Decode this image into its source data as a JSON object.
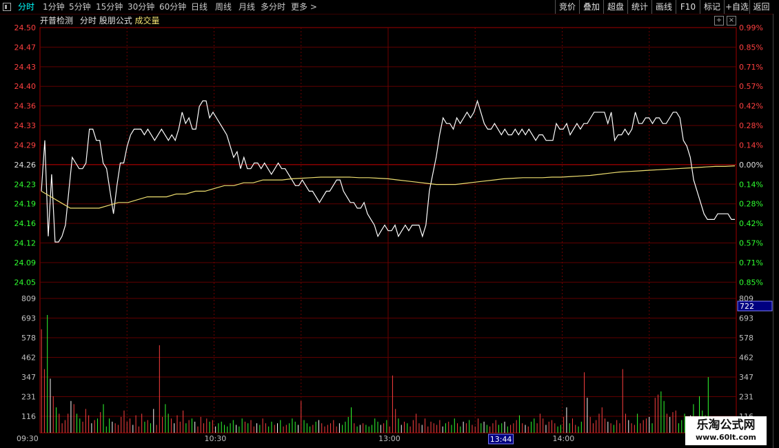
{
  "toolbar": {
    "left_tabs": [
      "分时",
      "1分钟",
      "5分钟",
      "15分钟",
      "30分钟",
      "60分钟",
      "日线",
      "周线",
      "月线",
      "多分时",
      "更多"
    ],
    "right_buttons": [
      "竞价",
      "叠加",
      "超盘",
      "统计",
      "画线",
      "F10",
      "标记",
      "+自选",
      "返回"
    ]
  },
  "subtitle": {
    "items": [
      "开普检测",
      "分时",
      "股朋公式",
      "成交量"
    ],
    "colors": [
      "#e0e0e0",
      "#e0e0e0",
      "#e0e0e0",
      "#f0e070"
    ]
  },
  "price_axis": {
    "left_labels": [
      "24.50",
      "24.47",
      "24.43",
      "24.40",
      "24.36",
      "24.33",
      "24.29",
      "24.26",
      "24.23",
      "24.19",
      "24.16",
      "24.12",
      "24.09",
      "24.05"
    ],
    "right_labels": [
      "0.99%",
      "0.85%",
      "0.71%",
      "0.57%",
      "0.42%",
      "0.28%",
      "0.14%",
      "0.00%",
      "0.14%",
      "0.28%",
      "0.42%",
      "0.57%",
      "0.71%",
      "0.85%"
    ],
    "prev_close": 24.26,
    "colors": {
      "up": "#ff4040",
      "flat": "#e0e0e0",
      "down": "#30ff30"
    }
  },
  "volume_axis": {
    "labels": [
      "809",
      "693",
      "578",
      "462",
      "347",
      "231",
      "116"
    ],
    "cursor_value": "722"
  },
  "time_axis": {
    "labels": [
      "09:30",
      "10:30",
      "13:00",
      "14:00"
    ],
    "cursor_time": "13:44"
  },
  "watermark": {
    "line1": "乐淘公式网",
    "line2": "www.60lt.com"
  },
  "chart_data": {
    "type": "line",
    "title": "",
    "xlabel": "",
    "ylabel": "",
    "x_range_minutes": [
      0,
      240
    ],
    "ylim": [
      24.02,
      24.5
    ],
    "series": [
      {
        "color": "#ffffff",
        "values": [
          24.21,
          24.3,
          24.13,
          24.24,
          24.12,
          24.12,
          24.13,
          24.15,
          24.21,
          24.27,
          24.26,
          24.25,
          24.25,
          24.26,
          24.32,
          24.32,
          24.3,
          24.3,
          24.26,
          24.25,
          24.21,
          24.17,
          24.22,
          24.26,
          24.26,
          24.29,
          24.31,
          24.32,
          24.32,
          24.32,
          24.31,
          24.32,
          24.31,
          24.3,
          24.31,
          24.32,
          24.31,
          24.3,
          24.31,
          24.3,
          24.32,
          24.35,
          24.33,
          24.34,
          24.32,
          24.32,
          24.36,
          24.37,
          24.37,
          24.34,
          24.35,
          24.34,
          24.33,
          24.32,
          24.31,
          24.29,
          24.27,
          24.28,
          24.25,
          24.27,
          24.25,
          24.25,
          24.26,
          24.26,
          24.25,
          24.26,
          24.25,
          24.24,
          24.25,
          24.26,
          24.25,
          24.25,
          24.24,
          24.23,
          24.22,
          24.22,
          24.23,
          24.22,
          24.21,
          24.21,
          24.2,
          24.19,
          24.2,
          24.21,
          24.21,
          24.22,
          24.23,
          24.23,
          24.21,
          24.2,
          24.19,
          24.19,
          24.18,
          24.18,
          24.19,
          24.17,
          24.16,
          24.15,
          24.13,
          24.14,
          24.15,
          24.14,
          24.14,
          24.15,
          24.13,
          24.14,
          24.15,
          24.14,
          24.15,
          24.15,
          24.15,
          24.13,
          24.15,
          24.21,
          24.24,
          24.27,
          24.31,
          24.34,
          24.33,
          24.33,
          24.32,
          24.34,
          24.33,
          24.34,
          24.35,
          24.34,
          24.35,
          24.37,
          24.35,
          24.33,
          24.32,
          24.32,
          24.33,
          24.32,
          24.31,
          24.32,
          24.31,
          24.31,
          24.32,
          24.31,
          24.32,
          24.31,
          24.32,
          24.31,
          24.3,
          24.31,
          24.31,
          24.3,
          24.3,
          24.3,
          24.33,
          24.32,
          24.32,
          24.33,
          24.31,
          24.32,
          24.33,
          24.32,
          24.33,
          24.33,
          24.34,
          24.35,
          24.35,
          24.35,
          24.35,
          24.33,
          24.35,
          24.3,
          24.31,
          24.31,
          24.32,
          24.31,
          24.32,
          24.35,
          24.33,
          24.33,
          24.34,
          24.34,
          24.33,
          24.34,
          24.34,
          24.33,
          24.33,
          24.34,
          24.35,
          24.35,
          24.34,
          24.3,
          24.29,
          24.27,
          24.23,
          24.21,
          24.19,
          24.17,
          24.16,
          24.16,
          24.16,
          24.17,
          24.17,
          24.17,
          24.17,
          24.16,
          24.16
        ]
      },
      {
        "color": "#f0e070",
        "values": [
          24.21,
          24.2,
          24.19,
          24.18,
          24.18,
          24.18,
          24.18,
          24.185,
          24.19,
          24.19,
          24.195,
          24.2,
          24.2,
          24.2,
          24.205,
          24.205,
          24.21,
          24.21,
          24.215,
          24.22,
          24.22,
          24.225,
          24.225,
          24.23,
          24.23,
          24.23,
          24.232,
          24.233,
          24.234,
          24.235,
          24.235,
          24.235,
          24.235,
          24.234,
          24.234,
          24.233,
          24.232,
          24.23,
          24.228,
          24.226,
          24.224,
          24.222,
          24.222,
          24.222,
          24.224,
          24.226,
          24.228,
          24.23,
          24.232,
          24.233,
          24.234,
          24.234,
          24.234,
          24.235,
          24.235,
          24.236,
          24.237,
          24.238,
          24.24,
          24.242,
          24.244,
          24.245,
          24.246,
          24.247,
          24.248,
          24.249,
          24.25,
          24.251,
          24.252,
          24.253,
          24.254,
          24.254,
          24.255
        ]
      }
    ],
    "volume_bars": [
      650,
      400,
      740,
      340,
      230,
      160,
      120,
      60,
      80,
      120,
      200,
      180,
      120,
      90,
      70,
      150,
      110,
      60,
      80,
      90,
      130,
      180,
      40,
      90,
      70,
      60,
      50,
      100,
      140,
      70,
      90,
      50,
      110,
      40,
      120,
      70,
      80,
      60,
      150,
      50,
      550,
      100,
      180,
      120,
      90,
      60,
      110,
      70,
      140,
      60,
      80,
      90,
      70,
      40,
      100,
      60,
      90,
      70,
      80,
      40,
      60,
      70,
      50,
      40,
      60,
      80,
      50,
      40,
      90,
      70,
      60,
      80,
      40,
      60,
      50,
      90,
      60,
      40,
      70,
      50,
      60,
      80,
      40,
      50,
      60,
      90,
      70,
      50,
      200,
      80,
      60,
      40,
      50,
      70,
      80,
      60,
      40,
      50,
      60,
      80,
      40,
      60,
      50,
      70,
      100,
      160,
      60,
      40,
      50,
      60,
      50,
      40,
      50,
      90,
      70,
      50,
      60,
      80,
      40,
      360,
      150,
      90,
      50,
      70,
      60,
      40,
      80,
      120,
      60,
      50,
      90,
      40,
      70,
      60,
      50,
      80,
      40,
      60,
      70,
      50,
      90,
      60,
      40,
      70,
      60,
      80,
      50,
      40,
      90,
      60,
      70,
      50,
      40,
      60,
      80,
      50,
      60,
      70,
      40,
      50,
      60,
      80,
      110,
      60,
      50,
      40,
      70,
      90,
      60,
      120,
      90,
      50,
      70,
      80,
      60,
      40,
      50,
      100,
      160,
      60,
      90,
      50,
      40,
      70,
      380,
      220,
      100,
      60,
      80,
      120,
      160,
      90,
      70,
      60,
      50,
      80,
      60,
      400,
      120,
      80,
      60,
      50,
      120,
      60,
      80,
      90,
      100,
      60,
      220,
      240,
      260,
      200,
      120,
      100,
      130,
      140,
      60,
      80,
      120,
      90,
      110,
      180,
      80,
      230,
      140,
      110,
      350,
      100,
      70,
      60,
      70,
      40,
      50,
      80,
      60,
      40
    ]
  }
}
